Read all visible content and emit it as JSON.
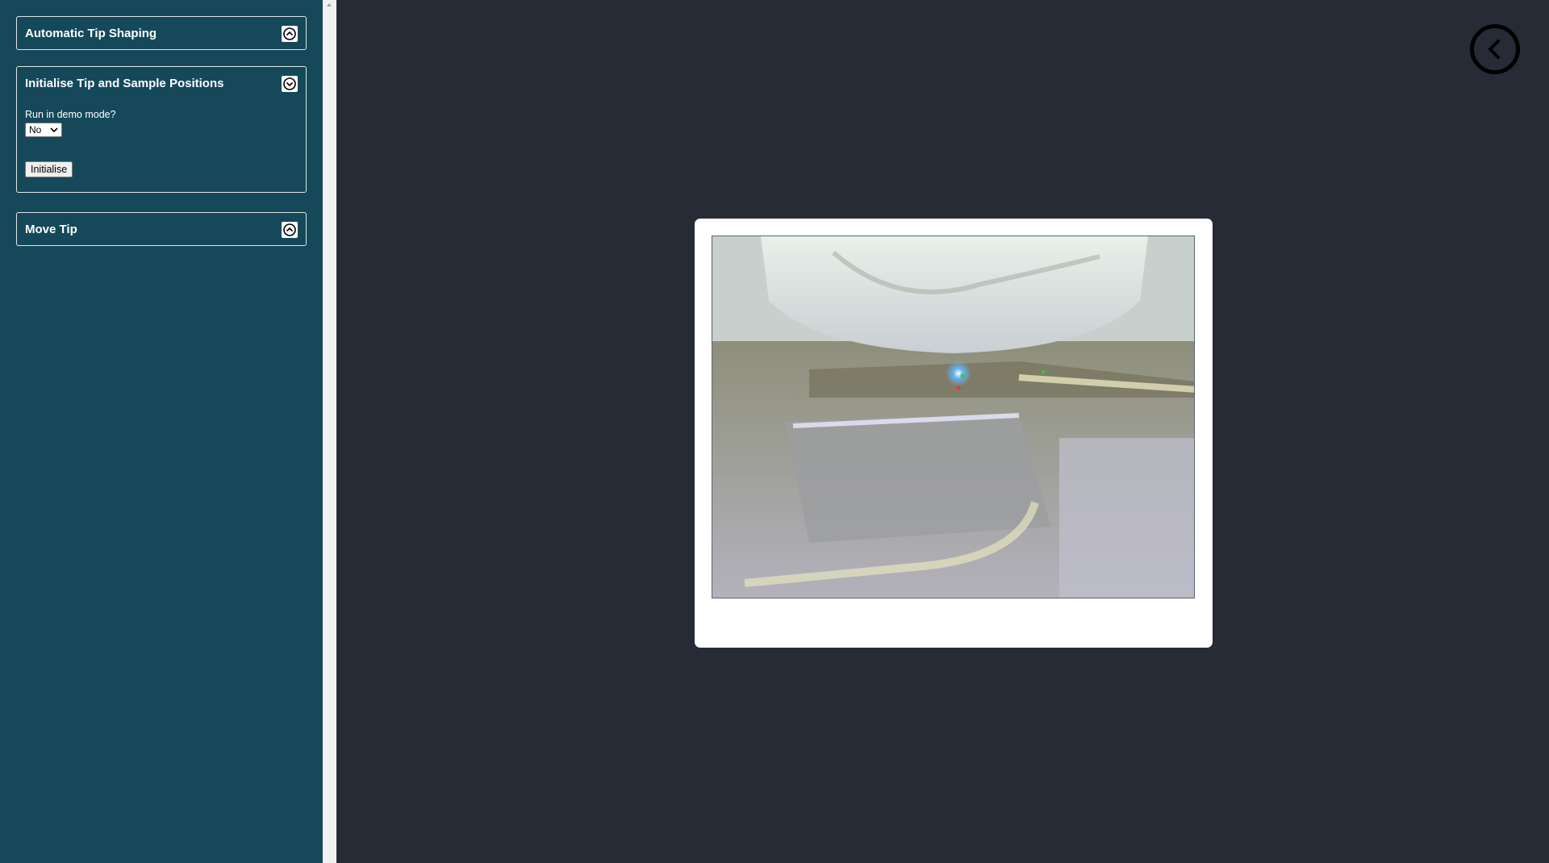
{
  "sidebar": {
    "panels": [
      {
        "title": "Automatic Tip Shaping",
        "state": "collapsed"
      },
      {
        "title": "Initialise Tip and Sample Positions",
        "state": "expanded",
        "demo_label": "Run in demo mode?",
        "demo_value": "No",
        "initialise_label": "Initialise"
      },
      {
        "title": "Move Tip",
        "state": "collapsed"
      }
    ]
  },
  "camera": {
    "markers": [
      "blue",
      "green",
      "red"
    ]
  },
  "colors": {
    "sidebar_bg": "#15495a",
    "main_bg": "#272b35",
    "card_bg": "#ffffff"
  }
}
